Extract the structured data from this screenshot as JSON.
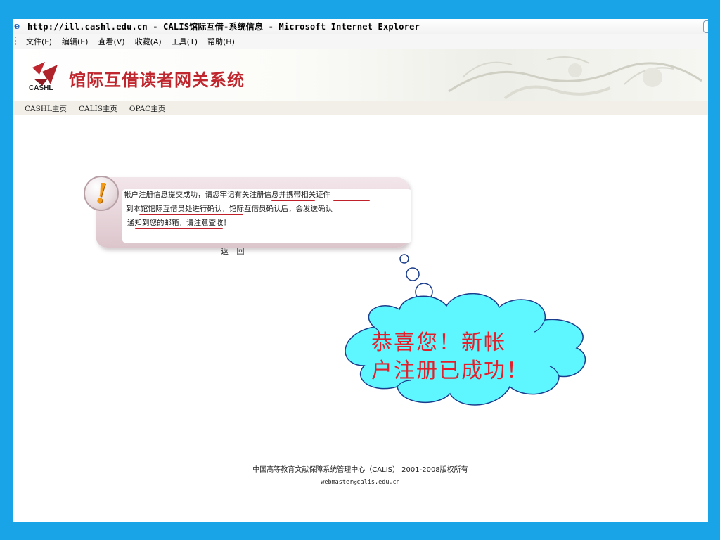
{
  "window": {
    "title": "http://ill.cashl.edu.cn - CALIS馆际互借-系统信息 - Microsoft Internet Explorer"
  },
  "menubar": {
    "items": [
      "文件(F)",
      "编辑(E)",
      "查看(V)",
      "收藏(A)",
      "工具(T)",
      "帮助(H)"
    ]
  },
  "banner": {
    "logo_text": "CASHL",
    "site_title": "馆际互借读者网关系统"
  },
  "nav": {
    "links": [
      "CASHL主页",
      "CALIS主页",
      "OPAC主页"
    ]
  },
  "message": {
    "icon": "exclamation-icon",
    "lines": [
      "帐户注册信息提交成功，请您牢记有关注册信息并携带相关证件",
      "到本馆馆际互借员处进行确认，馆际互借员确认后，会发送确认",
      "通知到您的邮箱，请注意查收！"
    ],
    "back_label": "返 回"
  },
  "callout": {
    "lines": [
      "恭喜您！新帐",
      "户注册已成功！"
    ],
    "fill_color": "#5ff7ff",
    "text_color": "#e21f2a"
  },
  "footer": {
    "copyright": "中国高等教育文献保障系统管理中心（CALIS） 2001-2008版权所有",
    "email": "webmaster@calis.edu.cn"
  },
  "colors": {
    "slide_background": "#1aa4e8",
    "title_accent": "#c0262d"
  }
}
